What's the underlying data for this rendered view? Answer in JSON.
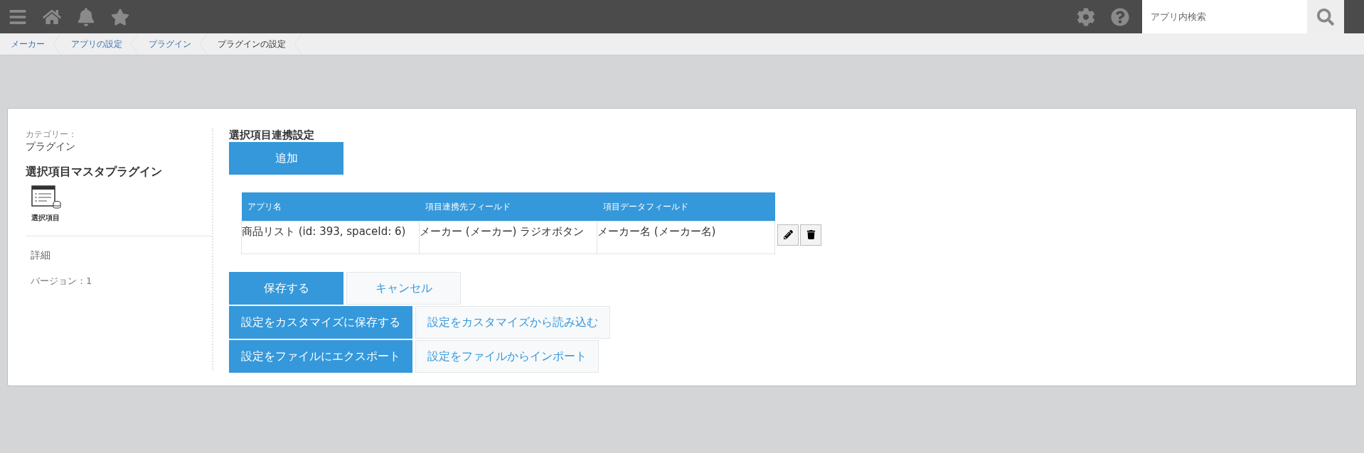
{
  "header": {
    "search": {
      "placeholder": "アプリ内検索"
    }
  },
  "breadcrumb": [
    {
      "label": "メーカー",
      "kind": "link"
    },
    {
      "label": "アプリの設定",
      "kind": "link"
    },
    {
      "label": "プラグイン",
      "kind": "link"
    },
    {
      "label": "プラグインの設定",
      "kind": "current"
    }
  ],
  "sidebar": {
    "category_label": "カテゴリー：",
    "category": "プラグイン",
    "plugin_name": "選択項目マスタプラグイン",
    "icon_caption": "選択項目",
    "details_link": "詳細",
    "version": "バージョン：1"
  },
  "main": {
    "title": "選択項目連携設定",
    "add_button": "追加",
    "table": {
      "columns": [
        "アプリ名",
        "項目連携先フィールド",
        "項目データフィールド"
      ],
      "rows": [
        [
          "商品リスト (id: 393, spaceId: 6)",
          "メーカー (メーカー) ラジオボタン",
          "メーカー名 (メーカー名)"
        ]
      ]
    },
    "button_rows": [
      [
        {
          "label": "保存する",
          "kind": "primary"
        },
        {
          "label": "キャンセル",
          "kind": "secondary"
        }
      ],
      [
        {
          "label": "設定をカスタマイズに保存する",
          "kind": "primary"
        },
        {
          "label": "設定をカスタマイズから読み込む",
          "kind": "secondary"
        }
      ],
      [
        {
          "label": "設定をファイルにエクスポート",
          "kind": "primary"
        },
        {
          "label": "設定をファイルからインポート",
          "kind": "secondary"
        }
      ]
    ]
  }
}
